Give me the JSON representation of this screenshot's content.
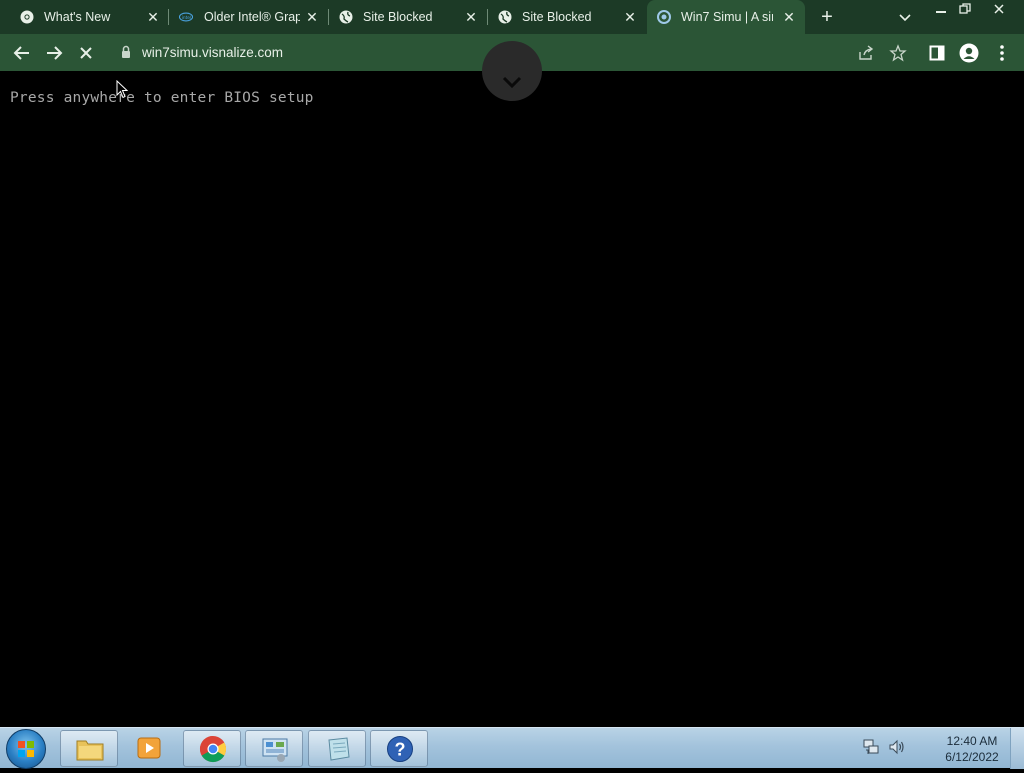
{
  "browser": {
    "tabs": [
      {
        "title": "What's New",
        "active": false
      },
      {
        "title": "Older Intel® Grap",
        "active": false
      },
      {
        "title": "Site Blocked",
        "active": false
      },
      {
        "title": "Site Blocked",
        "active": false
      },
      {
        "title": "Win7 Simu | A sim",
        "active": true
      }
    ],
    "url": "win7simu.visnalize.com",
    "theme_color": "#2b5536",
    "tabstrip_color": "#1c3a26"
  },
  "page": {
    "bios_message": "Press anywhere to enter BIOS setup"
  },
  "taskbar": {
    "apps": [
      "file-explorer",
      "media-player",
      "chrome",
      "control-panel",
      "notepad",
      "help"
    ],
    "clock_time": "12:40 AM",
    "clock_date": "6/12/2022"
  }
}
